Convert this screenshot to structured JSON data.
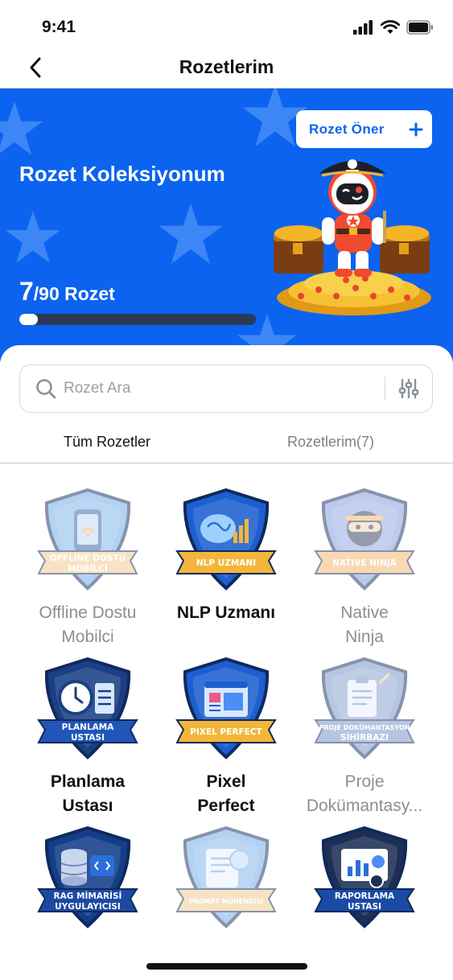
{
  "status": {
    "time": "9:41"
  },
  "nav": {
    "title": "Rozetlerim"
  },
  "hero": {
    "suggest_label": "Rozet Öner",
    "title": "Rozet Koleksiyonum",
    "count_earned": "7",
    "count_total_label": "/90 Rozet",
    "progress_fraction": 0.078
  },
  "search": {
    "placeholder": "Rozet Ara"
  },
  "tabs": {
    "all": "Tüm Rozetler",
    "mine": "Rozetlerim(7)"
  },
  "badges": [
    {
      "name": "Offline Dostu Mobilci",
      "ribbon": [
        "OFFLINE DOSTU",
        "MOBİLCİ"
      ],
      "locked": true,
      "color": "#6aa7e6",
      "ribbon_color": "#f1c88a",
      "icon": "phone-wifi-icon"
    },
    {
      "name": "NLP Uzmanı",
      "ribbon": [
        "NLP UZMANI"
      ],
      "locked": false,
      "color": "#1d5fd0",
      "ribbon_color": "#f4b63a",
      "icon": "brain-chart-icon"
    },
    {
      "name": "Native Ninja",
      "ribbon": [
        "NATIVE NINJA"
      ],
      "locked": true,
      "color": "#7b97d8",
      "ribbon_color": "#f2b56a",
      "icon": "ninja-icon"
    },
    {
      "name": "Planlama Ustası",
      "ribbon": [
        "PLANLAMA",
        "USTASI"
      ],
      "locked": false,
      "color": "#1b3f86",
      "ribbon_color": "#1f56b8",
      "icon": "clock-checklist-icon"
    },
    {
      "name": "Pixel Perfect",
      "ribbon": [
        "PIXEL PERFECT"
      ],
      "locked": false,
      "color": "#1d5fd0",
      "ribbon_color": "#f4b63a",
      "icon": "layout-window-icon"
    },
    {
      "name": "Proje Dokümantasy...",
      "ribbon": [
        "PROJE DOKÜMANTASYON",
        "SİHİRBAZI"
      ],
      "locked": true,
      "color": "#6f8fc7",
      "ribbon_color": "#6f8fc7",
      "icon": "clipboard-wand-icon"
    },
    {
      "name": "",
      "ribbon": [
        "RAG MİMARİSİ",
        "UYGULAYICISI"
      ],
      "locked": false,
      "color": "#143d8a",
      "ribbon_color": "#1b4aa5",
      "icon": "database-code-icon"
    },
    {
      "name": "",
      "ribbon": [
        "PROMPT MÜHENDİSİ"
      ],
      "locked": true,
      "color": "#6aa7e6",
      "ribbon_color": "#f1c88a",
      "icon": "document-ai-icon"
    },
    {
      "name": "",
      "ribbon": [
        "RAPORLAMA",
        "USTASI"
      ],
      "locked": false,
      "color": "#1d2f55",
      "ribbon_color": "#1b4aa5",
      "icon": "report-chart-icon"
    }
  ]
}
